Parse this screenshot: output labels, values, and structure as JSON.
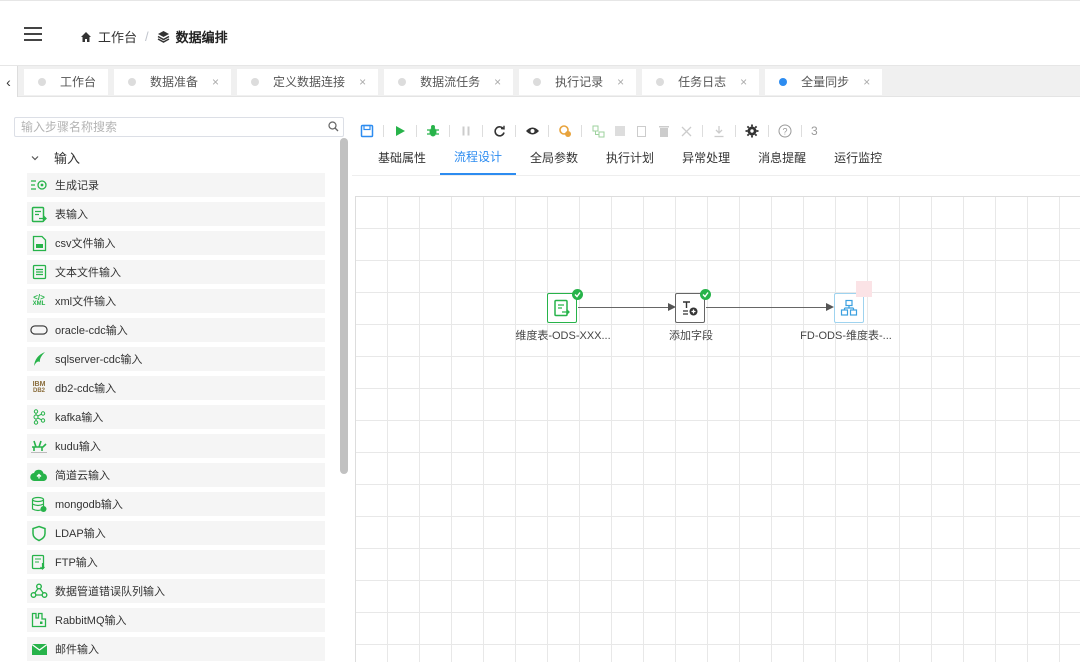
{
  "breadcrumb": {
    "home": "工作台",
    "separator": "/",
    "current": "数据编排"
  },
  "tabs": [
    {
      "label": "工作台",
      "closable": false,
      "active": false
    },
    {
      "label": "数据准备",
      "closable": true,
      "active": false
    },
    {
      "label": "定义数据连接",
      "closable": true,
      "active": false
    },
    {
      "label": "数据流任务",
      "closable": true,
      "active": false
    },
    {
      "label": "执行记录",
      "closable": true,
      "active": false
    },
    {
      "label": "任务日志",
      "closable": true,
      "active": false
    },
    {
      "label": "全量同步",
      "closable": true,
      "active": true
    }
  ],
  "tab_close_glyph": "×",
  "tab_left_glyph": "‹",
  "sidebar": {
    "search_placeholder": "输入步骤名称搜索",
    "group_label": "输入",
    "items": [
      {
        "label": "生成记录",
        "icon": "generate-records-icon"
      },
      {
        "label": "表输入",
        "icon": "table-input-icon"
      },
      {
        "label": "csv文件输入",
        "icon": "csv-file-icon"
      },
      {
        "label": "文本文件输入",
        "icon": "text-file-icon"
      },
      {
        "label": "xml文件输入",
        "icon": "xml-icon"
      },
      {
        "label": "oracle-cdc输入",
        "icon": "oracle-icon"
      },
      {
        "label": "sqlserver-cdc输入",
        "icon": "sqlserver-icon"
      },
      {
        "label": "db2-cdc输入",
        "icon": "ibm-db2-icon"
      },
      {
        "label": "kafka输入",
        "icon": "kafka-icon"
      },
      {
        "label": "kudu输入",
        "icon": "kudu-icon"
      },
      {
        "label": "简道云输入",
        "icon": "cloud-icon"
      },
      {
        "label": "mongodb输入",
        "icon": "mongodb-icon"
      },
      {
        "label": "LDAP输入",
        "icon": "shield-icon"
      },
      {
        "label": "FTP输入",
        "icon": "ftp-icon"
      },
      {
        "label": "数据管道错误队列输入",
        "icon": "pipeline-icon"
      },
      {
        "label": "RabbitMQ输入",
        "icon": "rabbitmq-icon"
      },
      {
        "label": "邮件输入",
        "icon": "mail-icon"
      }
    ],
    "xml_glyph": "</>",
    "xml_caption": "XML",
    "ibm_glyph": "IBM",
    "db2_caption": "DB2"
  },
  "toolbar": {
    "counter": "3",
    "help_glyph": "?"
  },
  "subtabs": [
    {
      "label": "基础属性",
      "active": false
    },
    {
      "label": "流程设计",
      "active": true
    },
    {
      "label": "全局参数",
      "active": false
    },
    {
      "label": "执行计划",
      "active": false
    },
    {
      "label": "异常处理",
      "active": false
    },
    {
      "label": "消息提醒",
      "active": false
    },
    {
      "label": "运行监控",
      "active": false
    }
  ],
  "flow": {
    "nodes": [
      {
        "label": "维度表-ODS-XXX...",
        "status": "success"
      },
      {
        "label": "添加字段",
        "status": "success"
      },
      {
        "label": "FD-ODS-维度表-...",
        "status": "pending"
      }
    ]
  },
  "colors": {
    "accent": "#2d8cf0",
    "green": "#27b34a",
    "success": "#27b34a",
    "pending": "#fbe3e6",
    "node_blue": "#3ba0e0"
  }
}
